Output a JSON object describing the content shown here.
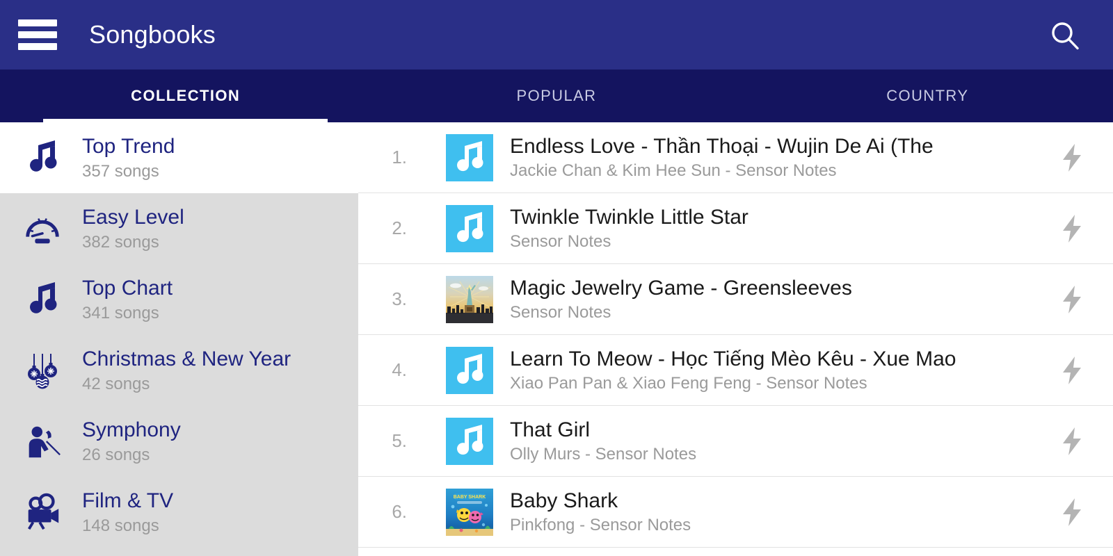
{
  "appbar": {
    "title": "Songbooks",
    "menu_icon": "hamburger-menu-icon",
    "search_icon": "search-icon"
  },
  "tabs": [
    {
      "label": "COLLECTION",
      "active": true
    },
    {
      "label": "POPULAR",
      "active": false
    },
    {
      "label": "COUNTRY",
      "active": false
    }
  ],
  "sidebar": {
    "items": [
      {
        "title": "Top Trend",
        "count": "357 songs",
        "icon": "music-note-icon",
        "selected": true
      },
      {
        "title": "Easy Level",
        "count": "382 songs",
        "icon": "speedometer-icon",
        "selected": false
      },
      {
        "title": "Top Chart",
        "count": "341 songs",
        "icon": "music-note-icon",
        "selected": false
      },
      {
        "title": "Christmas & New Year",
        "count": "42 songs",
        "icon": "ornaments-icon",
        "selected": false
      },
      {
        "title": "Symphony",
        "count": "26 songs",
        "icon": "conductor-icon",
        "selected": false
      },
      {
        "title": "Film & TV",
        "count": "148 songs",
        "icon": "movie-camera-icon",
        "selected": false
      }
    ]
  },
  "songlist": {
    "action_icon": "lightning-bolt-icon",
    "items": [
      {
        "rank": "1.",
        "title": "Endless Love - Thần Thoại - Wujin De Ai (The",
        "artist": "Jackie Chan & Kim Hee Sun - Sensor Notes",
        "art": "note"
      },
      {
        "rank": "2.",
        "title": "Twinkle Twinkle Little Star",
        "artist": "Sensor Notes",
        "art": "note"
      },
      {
        "rank": "3.",
        "title": "Magic Jewelry Game -  Greensleeves",
        "artist": "Sensor Notes",
        "art": "liberty"
      },
      {
        "rank": "4.",
        "title": "Learn To Meow - Học Tiếng Mèo Kêu - Xue Mao",
        "artist": "Xiao Pan Pan & Xiao Feng Feng - Sensor Notes",
        "art": "note"
      },
      {
        "rank": "5.",
        "title": "That Girl",
        "artist": "Olly Murs - Sensor Notes",
        "art": "note"
      },
      {
        "rank": "6.",
        "title": "Baby Shark",
        "artist": "Pinkfong - Sensor Notes",
        "art": "shark"
      }
    ]
  },
  "colors": {
    "appbar": "#2a2f87",
    "tabbar": "#14145f",
    "accent": "#1f2480",
    "thumb_blue": "#3fbfef",
    "sidebar_bg": "#dcdcdc",
    "muted_text": "#9a9a9a"
  }
}
